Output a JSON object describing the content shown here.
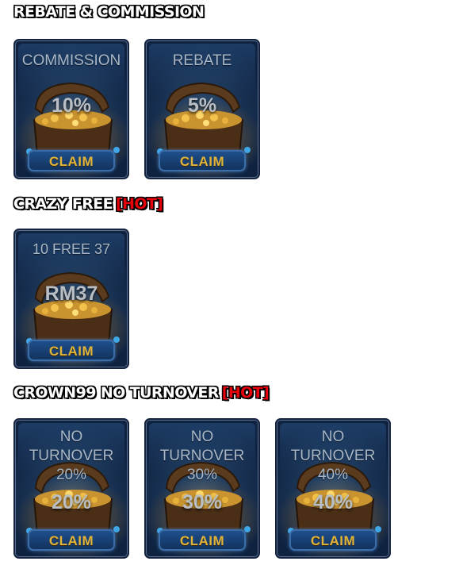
{
  "sections": [
    {
      "title": "REBATE & COMMISSION",
      "hot": "",
      "cards": [
        {
          "label": "COMMISSION",
          "value": "10%",
          "button": "CLAIM"
        },
        {
          "label": "REBATE",
          "value": "5%",
          "button": "CLAIM"
        }
      ]
    },
    {
      "title": "CRAZY FREE",
      "hot": "[HOT]",
      "cards": [
        {
          "label": "10 FREE 37",
          "value": "RM37",
          "button": "CLAIM"
        }
      ]
    },
    {
      "title": "CROWN99 NO TURNOVER",
      "hot": "[HOT]",
      "cards": [
        {
          "label_lines": [
            "NO",
            "TURNOVER",
            "20%"
          ],
          "value": "20%",
          "button": "CLAIM"
        },
        {
          "label_lines": [
            "NO",
            "TURNOVER",
            "30%"
          ],
          "value": "30%",
          "button": "CLAIM"
        },
        {
          "label_lines": [
            "NO",
            "TURNOVER",
            "40%"
          ],
          "value": "40%",
          "button": "CLAIM"
        }
      ]
    }
  ]
}
